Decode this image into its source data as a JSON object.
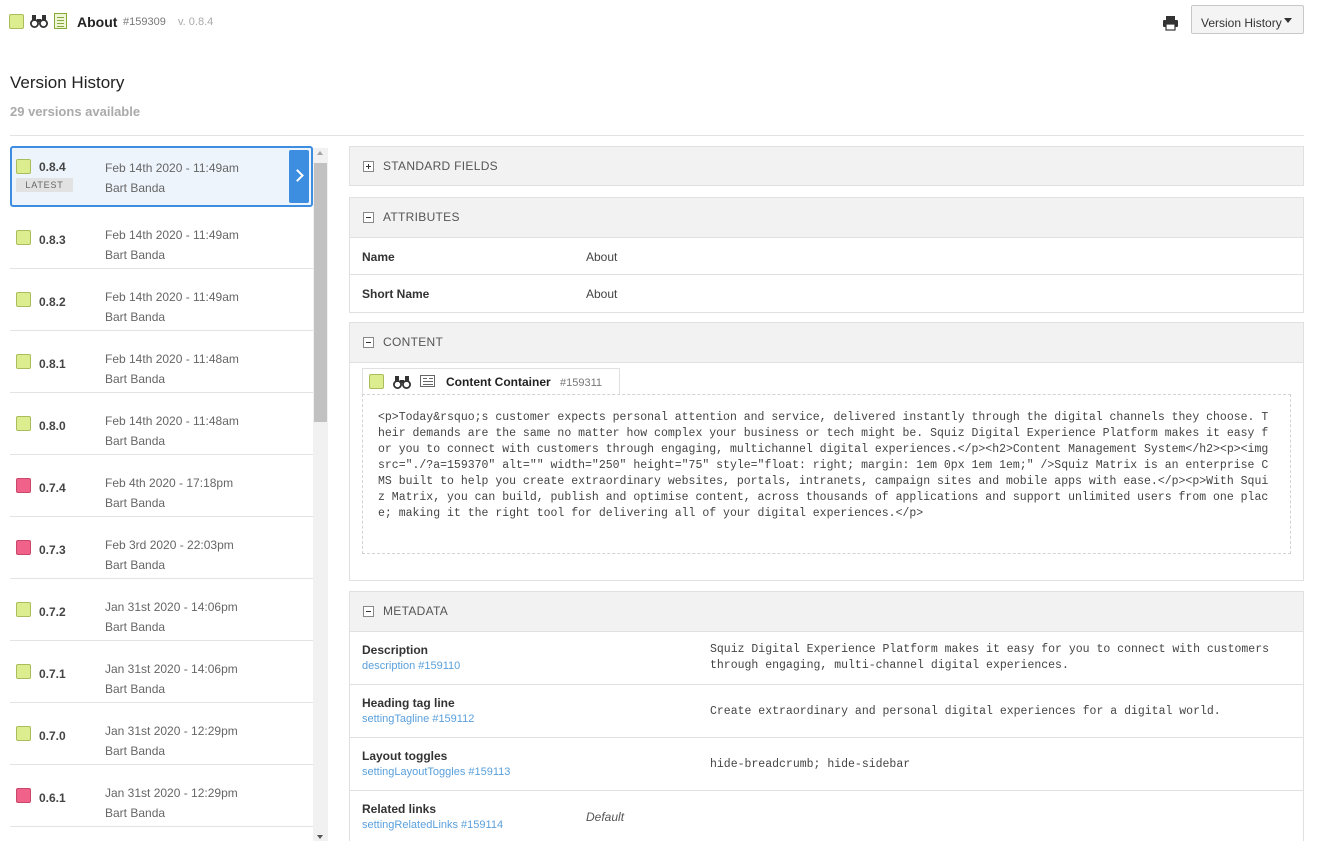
{
  "header": {
    "asset_title": "About",
    "asset_id": "#159309",
    "asset_version": "v. 0.8.4",
    "menu_button_label": "Version History",
    "status_color": "#dbed8f"
  },
  "page": {
    "heading": "Version History",
    "versions_count": "29 versions available"
  },
  "versions": [
    {
      "num": "0.8.4",
      "date": "Feb 14th 2020 - 11:49am",
      "author": "Bart Banda",
      "status": "green",
      "badge": "LATEST"
    },
    {
      "num": "0.8.3",
      "date": "Feb 14th 2020 - 11:49am",
      "author": "Bart Banda",
      "status": "green"
    },
    {
      "num": "0.8.2",
      "date": "Feb 14th 2020 - 11:49am",
      "author": "Bart Banda",
      "status": "green"
    },
    {
      "num": "0.8.1",
      "date": "Feb 14th 2020 - 11:48am",
      "author": "Bart Banda",
      "status": "green"
    },
    {
      "num": "0.8.0",
      "date": "Feb 14th 2020 - 11:48am",
      "author": "Bart Banda",
      "status": "green"
    },
    {
      "num": "0.7.4",
      "date": "Feb 4th 2020 - 17:18pm",
      "author": "Bart Banda",
      "status": "red"
    },
    {
      "num": "0.7.3",
      "date": "Feb 3rd 2020 - 22:03pm",
      "author": "Bart Banda",
      "status": "red"
    },
    {
      "num": "0.7.2",
      "date": "Jan 31st 2020 - 14:06pm",
      "author": "Bart Banda",
      "status": "green"
    },
    {
      "num": "0.7.1",
      "date": "Jan 31st 2020 - 14:06pm",
      "author": "Bart Banda",
      "status": "green"
    },
    {
      "num": "0.7.0",
      "date": "Jan 31st 2020 - 12:29pm",
      "author": "Bart Banda",
      "status": "green"
    },
    {
      "num": "0.6.1",
      "date": "Jan 31st 2020 - 12:29pm",
      "author": "Bart Banda",
      "status": "red"
    }
  ],
  "sections": {
    "standard_fields": "STANDARD FIELDS",
    "attributes": "ATTRIBUTES",
    "content": "CONTENT",
    "metadata": "METADATA"
  },
  "attributes": [
    {
      "label": "Name",
      "value": "About"
    },
    {
      "label": "Short Name",
      "value": "About"
    }
  ],
  "content": {
    "container_title": "Content Container",
    "container_id": "#159311",
    "html": "<p>Today&rsquo;s customer expects personal attention and service, delivered instantly through the digital channels they choose. Their demands are the same no matter how complex your business or tech might be. Squiz Digital Experience Platform makes it easy for you to connect with customers through engaging, multichannel digital experiences.</p><h2>Content Management System</h2><p><img src=\"./?a=159370\" alt=\"\" width=\"250\" height=\"75\" style=\"float: right; margin: 1em 0px 1em 1em;\" />Squiz Matrix is an enterprise CMS built to help you create extraordinary websites, portals, intranets, campaign sites and mobile apps with ease.</p><p>With Squiz Matrix, you can build, publish and optimise content, across thousands of applications and support unlimited users from one place; making it the right tool for delivering all of your digital experiences.</p>"
  },
  "metadata": [
    {
      "label": "Description",
      "field": "description #159110",
      "value": "Squiz Digital Experience Platform makes it easy for you to connect with customers through engaging, multi-channel digital experiences."
    },
    {
      "label": "Heading tag line",
      "field": "settingTagline #159112",
      "value": "Create extraordinary and personal digital experiences for a digital world."
    },
    {
      "label": "Layout toggles",
      "field": "settingLayoutToggles #159113",
      "value": "hide-breadcrumb; hide-sidebar"
    },
    {
      "label": "Related links",
      "field": "settingRelatedLinks #159114",
      "default": "Default"
    }
  ],
  "colors": {
    "accent": "#3d8ee0",
    "status_green": "#dbed8f",
    "status_red": "#f0628a",
    "link": "#5aa0dc"
  }
}
